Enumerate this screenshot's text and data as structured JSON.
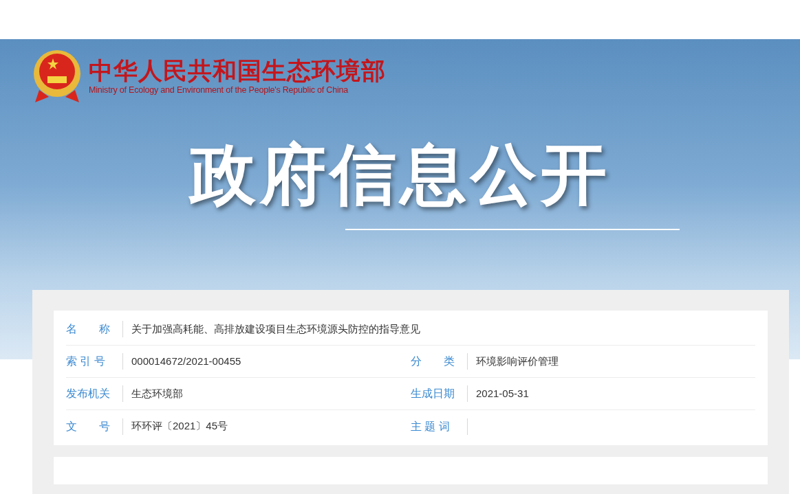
{
  "header": {
    "title": "中华人民共和国生态环境部",
    "subtitle": "Ministry of Ecology and Environment of the People's Republic of China"
  },
  "banner": {
    "heading": "政府信息公开"
  },
  "info_rows": [
    {
      "fields": [
        {
          "label": "名　　称",
          "value": "关于加强高耗能、高排放建设项目生态环境源头防控的指导意见"
        }
      ]
    },
    {
      "fields": [
        {
          "label": "索 引 号",
          "value": "000014672/2021-00455"
        },
        {
          "label": "分　　类",
          "value": "环境影响评价管理"
        }
      ]
    },
    {
      "fields": [
        {
          "label": "发布机关",
          "value": "生态环境部"
        },
        {
          "label": "生成日期",
          "value": "2021-05-31"
        }
      ]
    },
    {
      "fields": [
        {
          "label": "文　　号",
          "value": "环环评〔2021〕45号"
        },
        {
          "label": "主 题 词"
        }
      ]
    }
  ]
}
